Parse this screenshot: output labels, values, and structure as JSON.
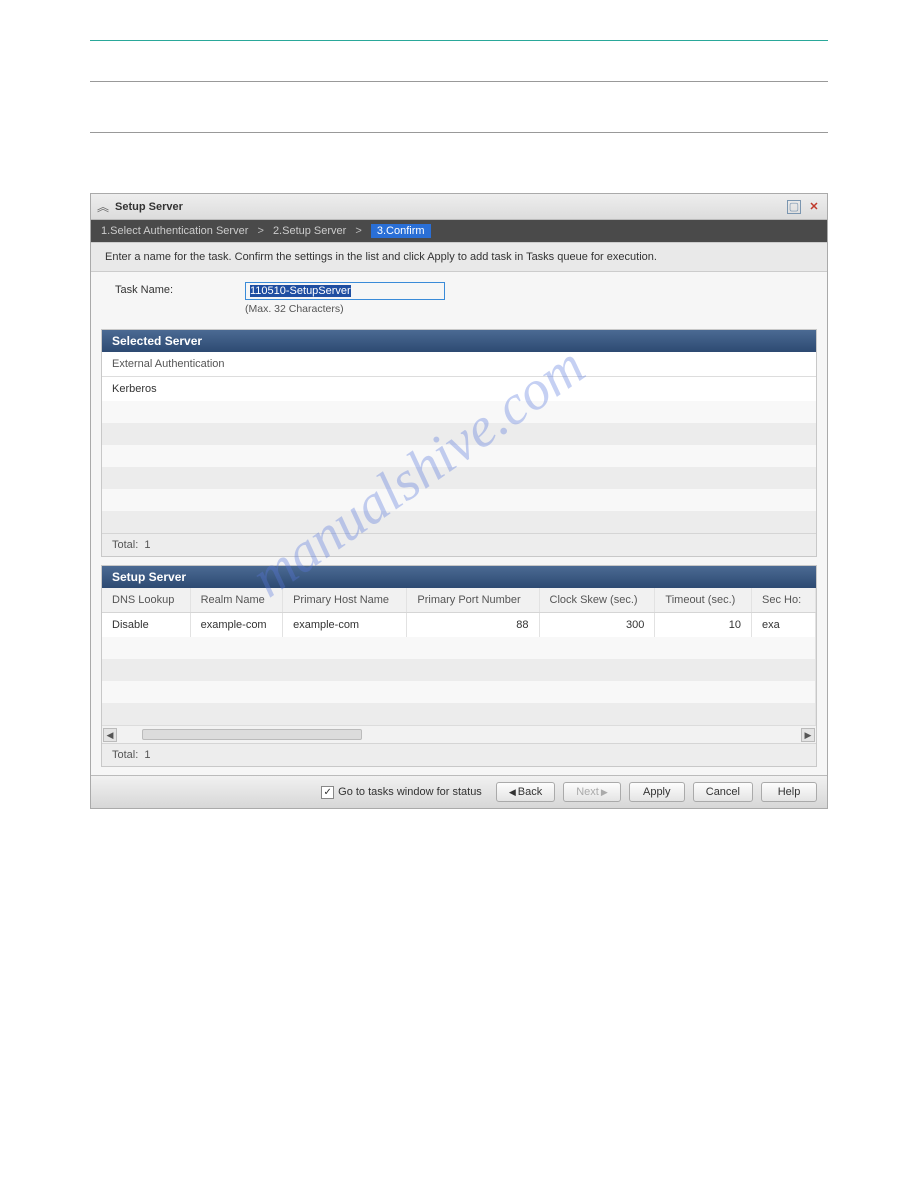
{
  "window": {
    "title": "Setup Server"
  },
  "breadcrumb": {
    "step1": "1.Select Authentication Server",
    "step2": "2.Setup Server",
    "step3": "3.Confirm",
    "sep": ">"
  },
  "instruction": "Enter a name for the task. Confirm the settings in the list and click Apply to add task in Tasks queue for execution.",
  "task": {
    "label": "Task Name:",
    "value": "110510-SetupServer",
    "hint": "(Max. 32 Characters)"
  },
  "selected_server": {
    "title": "Selected Server",
    "col_label": "External Authentication",
    "row_value": "Kerberos",
    "footer_label": "Total:",
    "footer_value": "1"
  },
  "setup_server": {
    "title": "Setup Server",
    "columns": {
      "dns_lookup": "DNS Lookup",
      "realm_name": "Realm Name",
      "primary_host": "Primary Host Name",
      "primary_port": "Primary Port Number",
      "clock_skew": "Clock Skew (sec.)",
      "timeout": "Timeout (sec.)",
      "sec_host": "Sec Ho:"
    },
    "row": {
      "dns_lookup": "Disable",
      "realm_name": "example-com",
      "primary_host": "example-com",
      "primary_port": "88",
      "clock_skew": "300",
      "timeout": "10",
      "sec_host": "exa"
    },
    "footer_label": "Total:",
    "footer_value": "1"
  },
  "footer": {
    "checkbox_label": "Go to tasks window for status",
    "checkbox_checked": true,
    "back": "Back",
    "next": "Next",
    "apply": "Apply",
    "cancel": "Cancel",
    "help": "Help"
  },
  "watermark": "manualshive.com"
}
